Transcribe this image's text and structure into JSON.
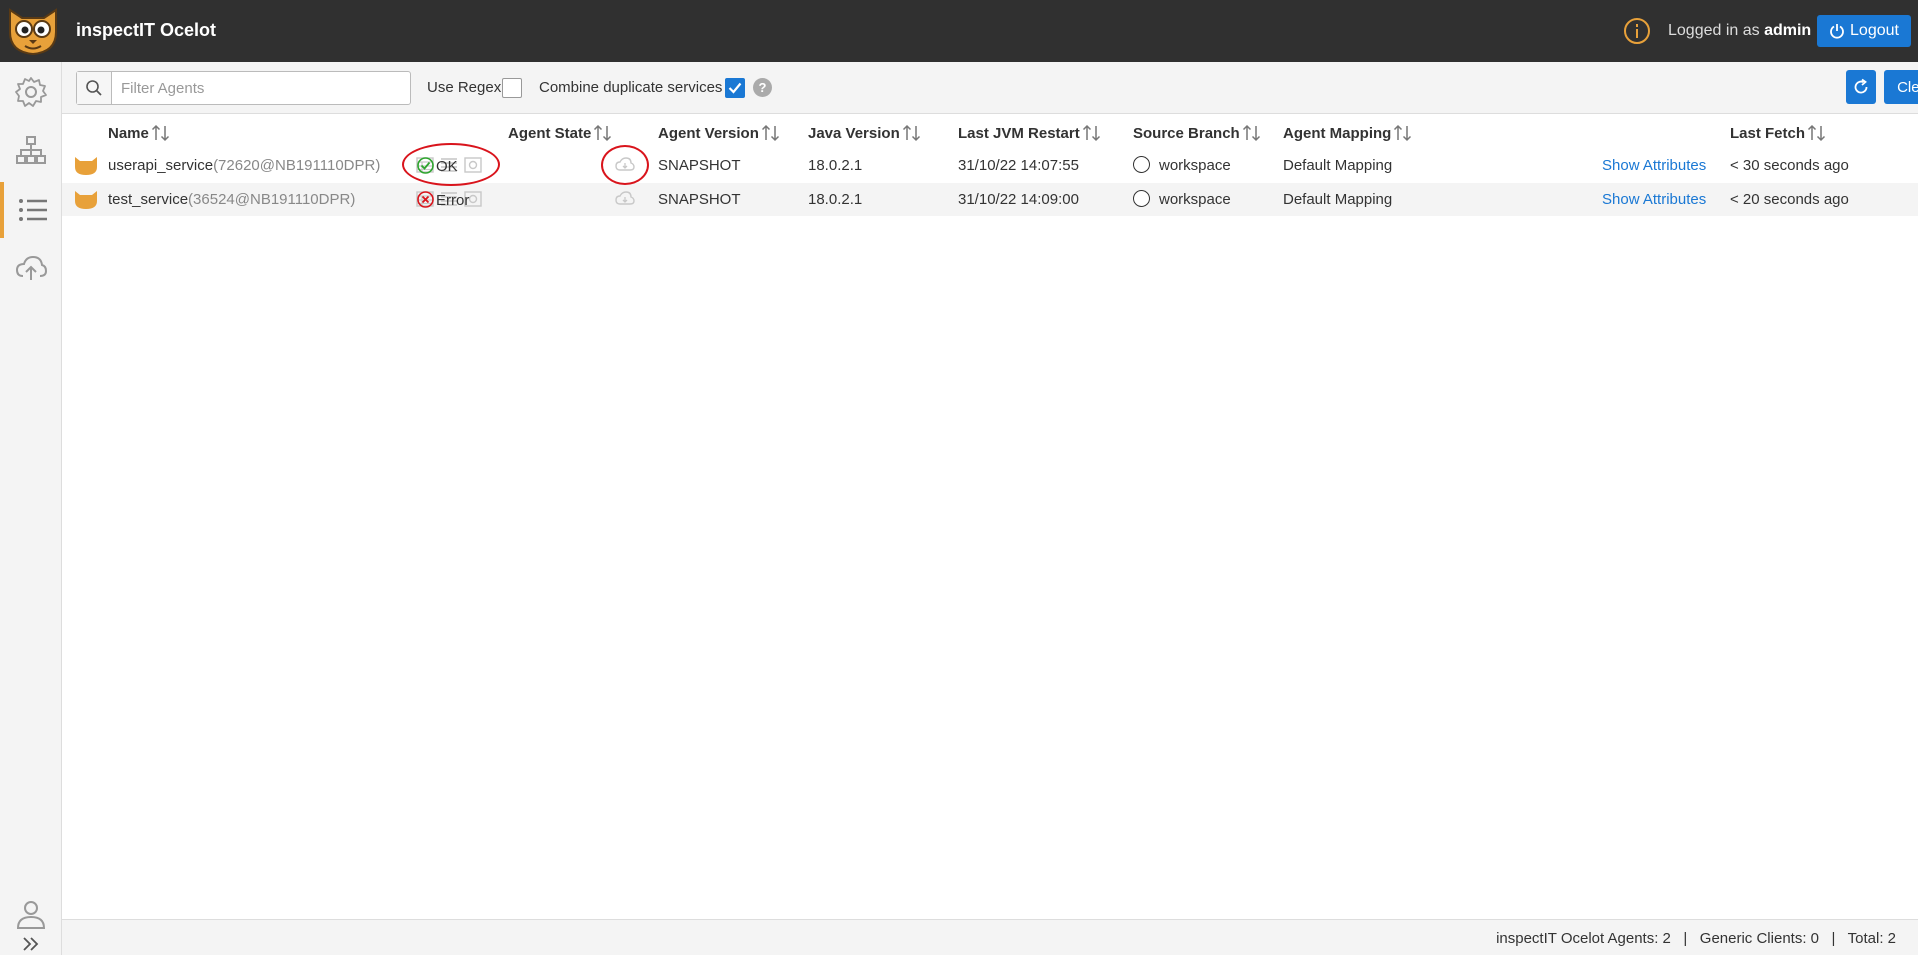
{
  "header": {
    "app_title": "inspectIT Ocelot",
    "logged_in_prefix": "Logged in as ",
    "username": "admin",
    "logout_label": "Logout"
  },
  "sidebar": {
    "items": [
      {
        "icon": "gear-icon"
      },
      {
        "icon": "hierarchy-icon"
      },
      {
        "icon": "list-icon",
        "active": true
      },
      {
        "icon": "cloud-upload-icon"
      }
    ],
    "bottom": [
      {
        "icon": "user-icon"
      },
      {
        "icon": "expand-icon"
      }
    ]
  },
  "toolbar": {
    "search_placeholder": "Filter Agents",
    "search_value": "",
    "use_regex_label": "Use Regex",
    "use_regex_checked": false,
    "combine_label": "Combine duplicate services",
    "combine_checked": true,
    "help_label": "?",
    "clear_all_label": "Clear All"
  },
  "table": {
    "headers": [
      "Name",
      "Agent State",
      "Agent Version",
      "Java Version",
      "Last JVM Restart",
      "Source Branch",
      "Agent Mapping",
      "Last Fetch"
    ],
    "rows": [
      {
        "name": "userapi_service",
        "id": "(72620@NB191110DPR)",
        "state": "OK",
        "agent_version": "SNAPSHOT",
        "java_version": "18.0.2.1",
        "last_restart": "31/10/22 14:07:55",
        "source_branch": "workspace",
        "mapping": "Default Mapping",
        "attributes_link": "Show Attributes",
        "last_fetch": "< 30 seconds ago"
      },
      {
        "name": "test_service",
        "id": "(36524@NB191110DPR)",
        "state": "Error",
        "agent_version": "SNAPSHOT",
        "java_version": "18.0.2.1",
        "last_restart": "31/10/22 14:09:00",
        "source_branch": "workspace",
        "mapping": "Default Mapping",
        "attributes_link": "Show Attributes",
        "last_fetch": "< 20 seconds ago"
      }
    ]
  },
  "footer": {
    "text": "inspectIT Ocelot Agents: 2   |   Generic Clients: 0   |   Total: 2"
  },
  "colors": {
    "accent": "#1a78d4",
    "brand": "#e8a13a",
    "ok": "#2ea52e",
    "error": "#d9141c",
    "annotation": "#d9141c"
  }
}
